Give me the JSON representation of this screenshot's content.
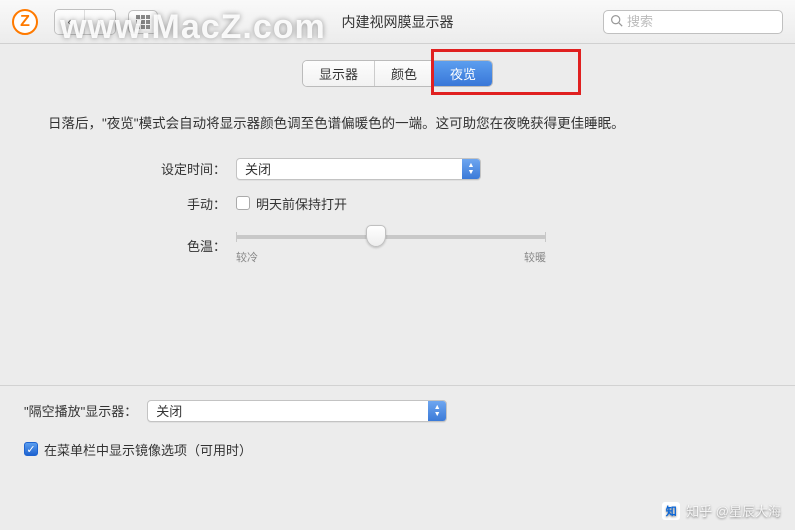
{
  "watermark": "www.MacZ.com",
  "window_title": "内建视网膜显示器",
  "search": {
    "placeholder": "搜索"
  },
  "tabs": [
    {
      "label": "显示器",
      "active": false
    },
    {
      "label": "颜色",
      "active": false
    },
    {
      "label": "夜览",
      "active": true
    }
  ],
  "description": "日落后，\"夜览\"模式会自动将显示器颜色调至色谱偏暖色的一端。这可助您在夜晚获得更佳睡眠。",
  "form": {
    "schedule_label": "设定时间：",
    "schedule_value": "关闭",
    "manual_label": "手动：",
    "manual_checkbox_label": "明天前保持打开",
    "color_temp_label": "色温：",
    "slider_min_label": "较冷",
    "slider_max_label": "较暖"
  },
  "airplay": {
    "label": "\"隔空播放\"显示器：",
    "value": "关闭"
  },
  "mirror_checkbox_label": "在菜单栏中显示镜像选项（可用时）",
  "zhihu": {
    "brand": "知",
    "user": "知乎 @星辰大海"
  }
}
